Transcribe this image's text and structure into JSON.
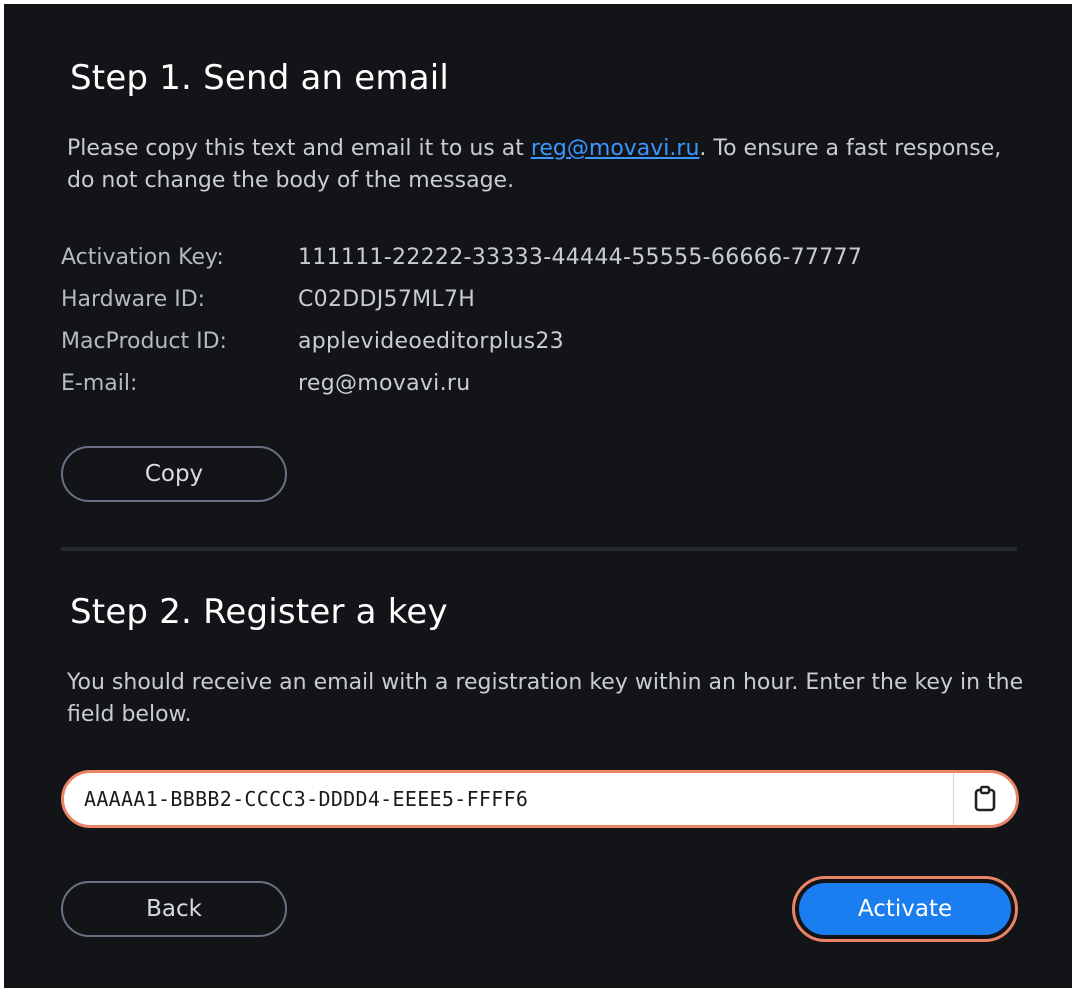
{
  "step1": {
    "title": "Step 1. Send an email",
    "desc_before": "Please copy this text and email it to us at ",
    "desc_link": "reg@movavi.ru",
    "desc_after": ". To ensure a fast response, do not change the body of the message.",
    "info": [
      {
        "label": "Activation Key:",
        "value": "111111-22222-33333-44444-55555-66666-77777"
      },
      {
        "label": "Hardware ID:",
        "value": "C02DDJ57ML7H"
      },
      {
        "label": "MacProduct ID:",
        "value": "applevideoeditorplus23"
      },
      {
        "label": "E-mail:",
        "value": "reg@movavi.ru"
      }
    ],
    "copy_label": "Copy"
  },
  "step2": {
    "title": "Step 2. Register a key",
    "desc": "You should receive an email with a registration key within an hour. Enter the key in the field below.",
    "key_value": "AAAAA1-BBBB2-CCCC3-DDDD4-EEEE5-FFFF6",
    "paste_icon": "clipboard-icon",
    "back_label": "Back",
    "activate_label": "Activate"
  },
  "colors": {
    "background": "#131417",
    "accent": "#1a7df0",
    "highlight": "#e98464",
    "link": "#3a97ff"
  }
}
